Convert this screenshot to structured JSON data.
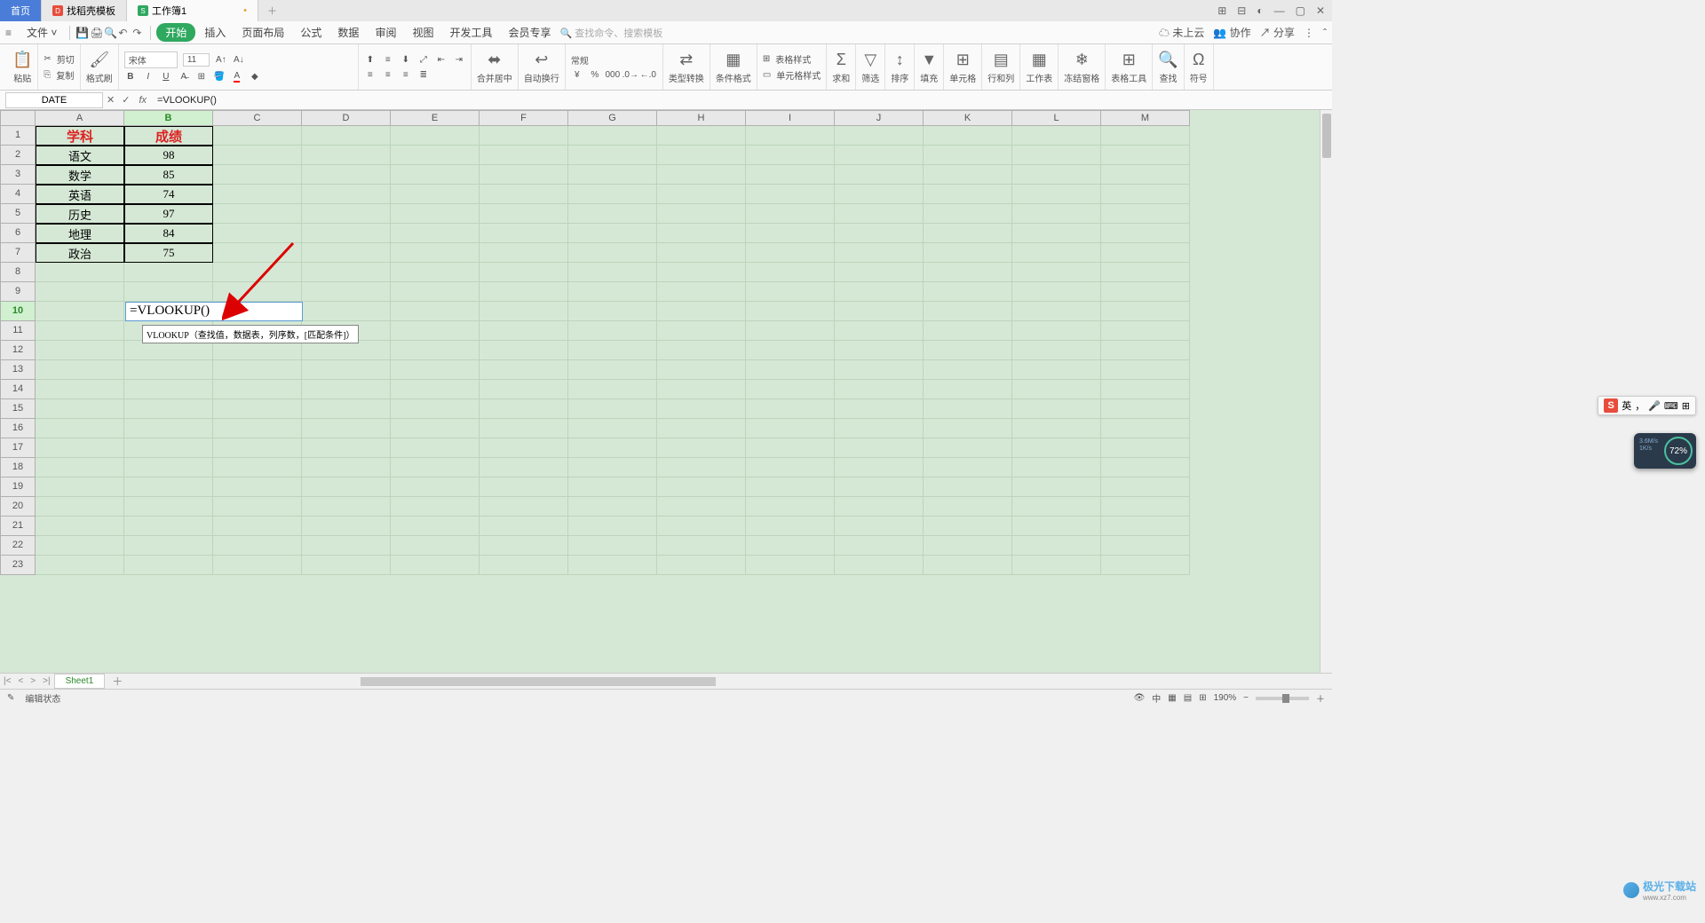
{
  "tabs": {
    "home": "首页",
    "docer": "找稻壳模板",
    "workbook": "工作簿1"
  },
  "winctrl": {
    "grid": "⊞",
    "apps": "⊟",
    "avatar": "◐",
    "min": "—",
    "max": "▢",
    "close": "✕"
  },
  "menu": {
    "file": "文件",
    "items": [
      "开始",
      "插入",
      "页面布局",
      "公式",
      "数据",
      "审阅",
      "视图",
      "开发工具",
      "会员专享"
    ],
    "searchPlaceholder": "查找命令、搜索模板",
    "right": {
      "cloud": "未上云",
      "coop": "协作",
      "share": "分享"
    }
  },
  "ribbon": {
    "paste": "粘贴",
    "cut": "剪切",
    "copy": "复制",
    "format": "格式刷",
    "fontName": "宋体",
    "fontSize": "11",
    "merge": "合并居中",
    "wrap": "自动换行",
    "numfmt": "常规",
    "typeconv": "类型转换",
    "cond": "条件格式",
    "tablestyle": "表格样式",
    "cellstyle": "单元格样式",
    "sum": "求和",
    "filter": "筛选",
    "sort": "排序",
    "fill": "填充",
    "cell": "单元格",
    "rowcol": "行和列",
    "sheet": "工作表",
    "freeze": "冻结窗格",
    "tabletool": "表格工具",
    "find": "查找",
    "symbol": "符号"
  },
  "fbar": {
    "name": "DATE",
    "formula": "=VLOOKUP()"
  },
  "columns": [
    "A",
    "B",
    "C",
    "D",
    "E",
    "F",
    "G",
    "H",
    "I",
    "J",
    "K",
    "L",
    "M"
  ],
  "rowCount": 23,
  "tableData": {
    "headers": [
      "学科",
      "成绩"
    ],
    "rows": [
      [
        "语文",
        "98"
      ],
      [
        "数学",
        "85"
      ],
      [
        "英语",
        "74"
      ],
      [
        "历史",
        "97"
      ],
      [
        "地理",
        "84"
      ],
      [
        "政治",
        "75"
      ]
    ]
  },
  "edit": {
    "text": "=VLOOKUP()",
    "tooltip": "VLOOKUP（查找值，数据表，列序数，[匹配条件]）"
  },
  "sheet": {
    "name": "Sheet1"
  },
  "status": {
    "mode": "编辑状态",
    "zoom": "190%"
  },
  "ime": {
    "lang": "英",
    "punct": "，",
    "mic": "🎤",
    "kbd": "⌨",
    "more": "⊞"
  },
  "widget": {
    "pct": "72%",
    "net1": "3.6M/s",
    "net2": "1K/s"
  },
  "watermark": {
    "text": "极光下载站",
    "sub": "www.xz7.com"
  },
  "chart_data": {
    "type": "table",
    "title": "成绩",
    "categories": [
      "语文",
      "数学",
      "英语",
      "历史",
      "地理",
      "政治"
    ],
    "values": [
      98,
      85,
      74,
      97,
      84,
      75
    ],
    "xlabel": "学科",
    "ylabel": "成绩"
  }
}
